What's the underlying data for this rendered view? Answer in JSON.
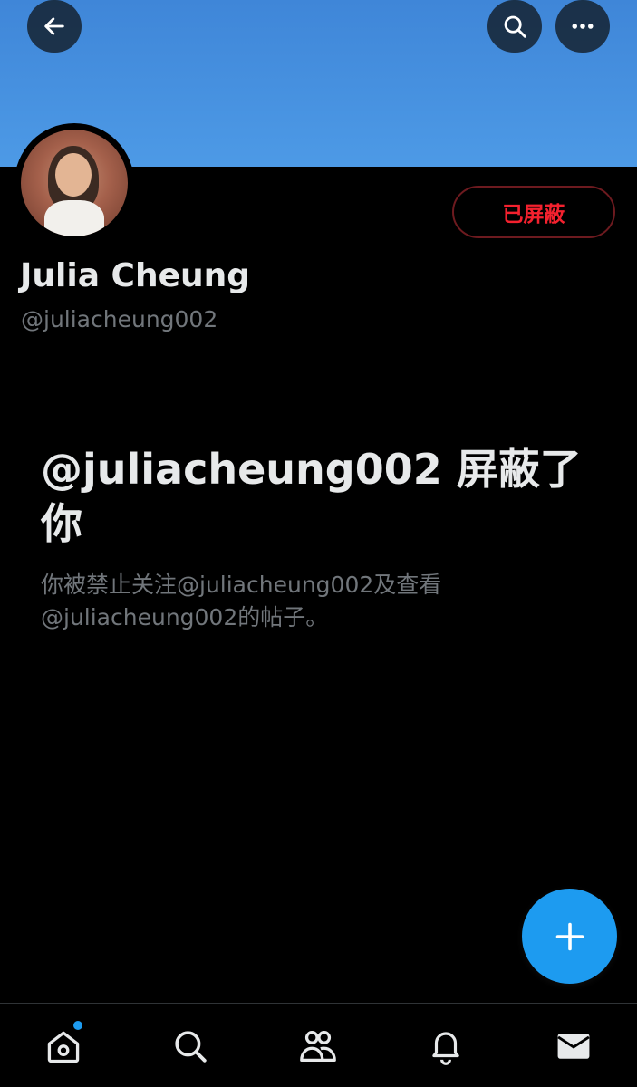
{
  "header": {
    "back_icon": "arrow-left-icon",
    "search_icon": "search-icon",
    "more_icon": "more-horizontal-icon"
  },
  "profile": {
    "display_name": "Julia Cheung",
    "handle": "@juliacheung002",
    "blocked_button_label": "已屏蔽"
  },
  "blocked_notice": {
    "title": "@juliacheung002 屏蔽了你",
    "description": "你被禁止关注@juliacheung002及查看@juliacheung002的帖子。"
  },
  "fab": {
    "icon": "plus-icon"
  },
  "bottom_nav": {
    "items": [
      {
        "icon": "home-icon",
        "has_badge": true
      },
      {
        "icon": "search-icon"
      },
      {
        "icon": "communities-icon"
      },
      {
        "icon": "bell-icon"
      },
      {
        "icon": "mail-icon"
      }
    ]
  },
  "colors": {
    "banner": "#4d9ae6",
    "accent": "#1d9bf0",
    "blocked_red": "#f4212e",
    "text_primary": "#e7e9ea",
    "text_secondary": "#71767b",
    "background": "#000000"
  }
}
